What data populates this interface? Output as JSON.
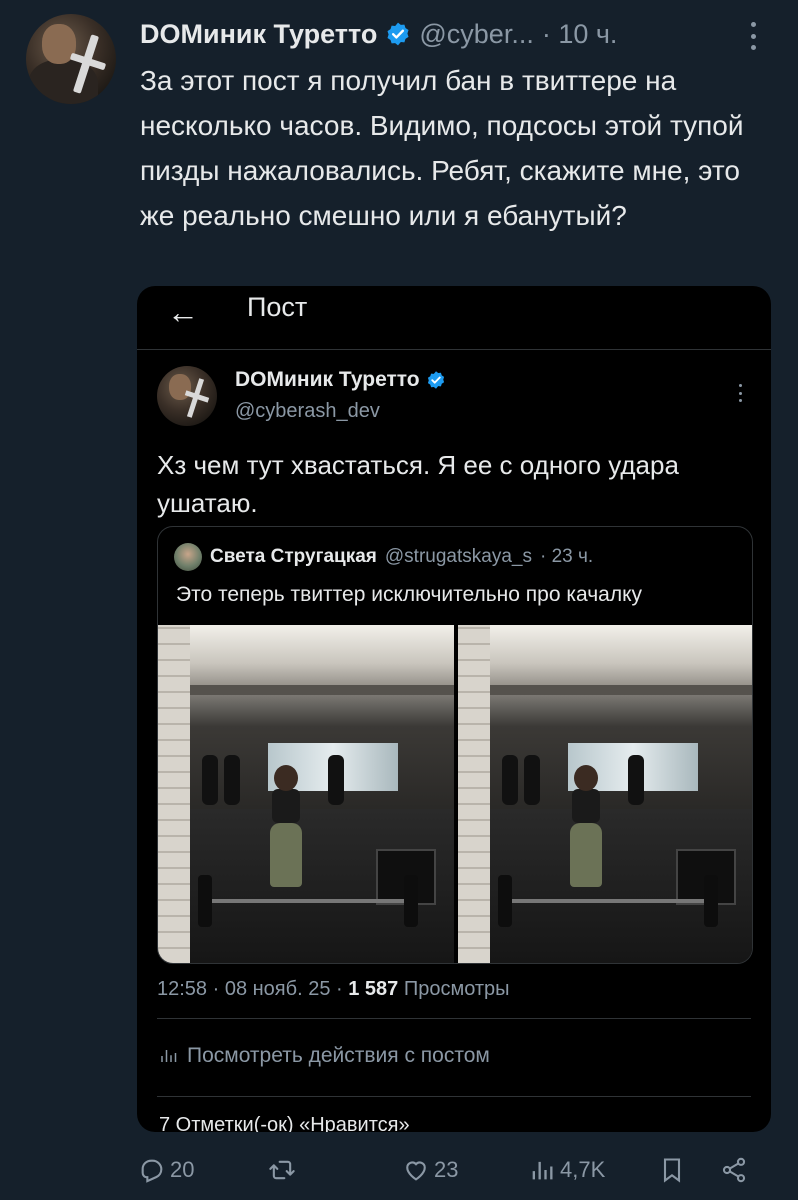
{
  "tweet": {
    "author_name": "DOМиник Туретто",
    "author_handle": "@cyber...",
    "time": "· 10 ч.",
    "text": "За этот пост я получил бан в твиттере на несколько часов. Видимо, подсосы этой тупой пизды нажаловались. Ребят, скажите мне, это же реально смешно или я ебанутый?"
  },
  "screenshot": {
    "header_title": "Пост",
    "author_name": "DOМиник Туретто",
    "author_handle": "@cyberash_dev",
    "text": "Хз чем тут хвастаться. Я ее с одного удара ушатаю.",
    "quote": {
      "author_name": "Света Стругацкая",
      "author_handle": "@strugatskaya_s",
      "time": "· 23 ч.",
      "text": "Это теперь твиттер исключительно про качалку"
    },
    "meta": {
      "datetime": "12:58 · 08 нояб. 25 ·",
      "views_count": "1 587",
      "views_label": "Просмотры"
    },
    "activity_label": "Посмотреть действия с постом",
    "likes_line": "7 Отметки(-ок) «Нравится»"
  },
  "actions": {
    "replies": "20",
    "retweets": "",
    "likes": "23",
    "views": "4,7K"
  },
  "colors": {
    "background": "#15202b",
    "text": "#e7e9ea",
    "secondary": "#8b98a5",
    "verified": "#1d9bf0"
  }
}
